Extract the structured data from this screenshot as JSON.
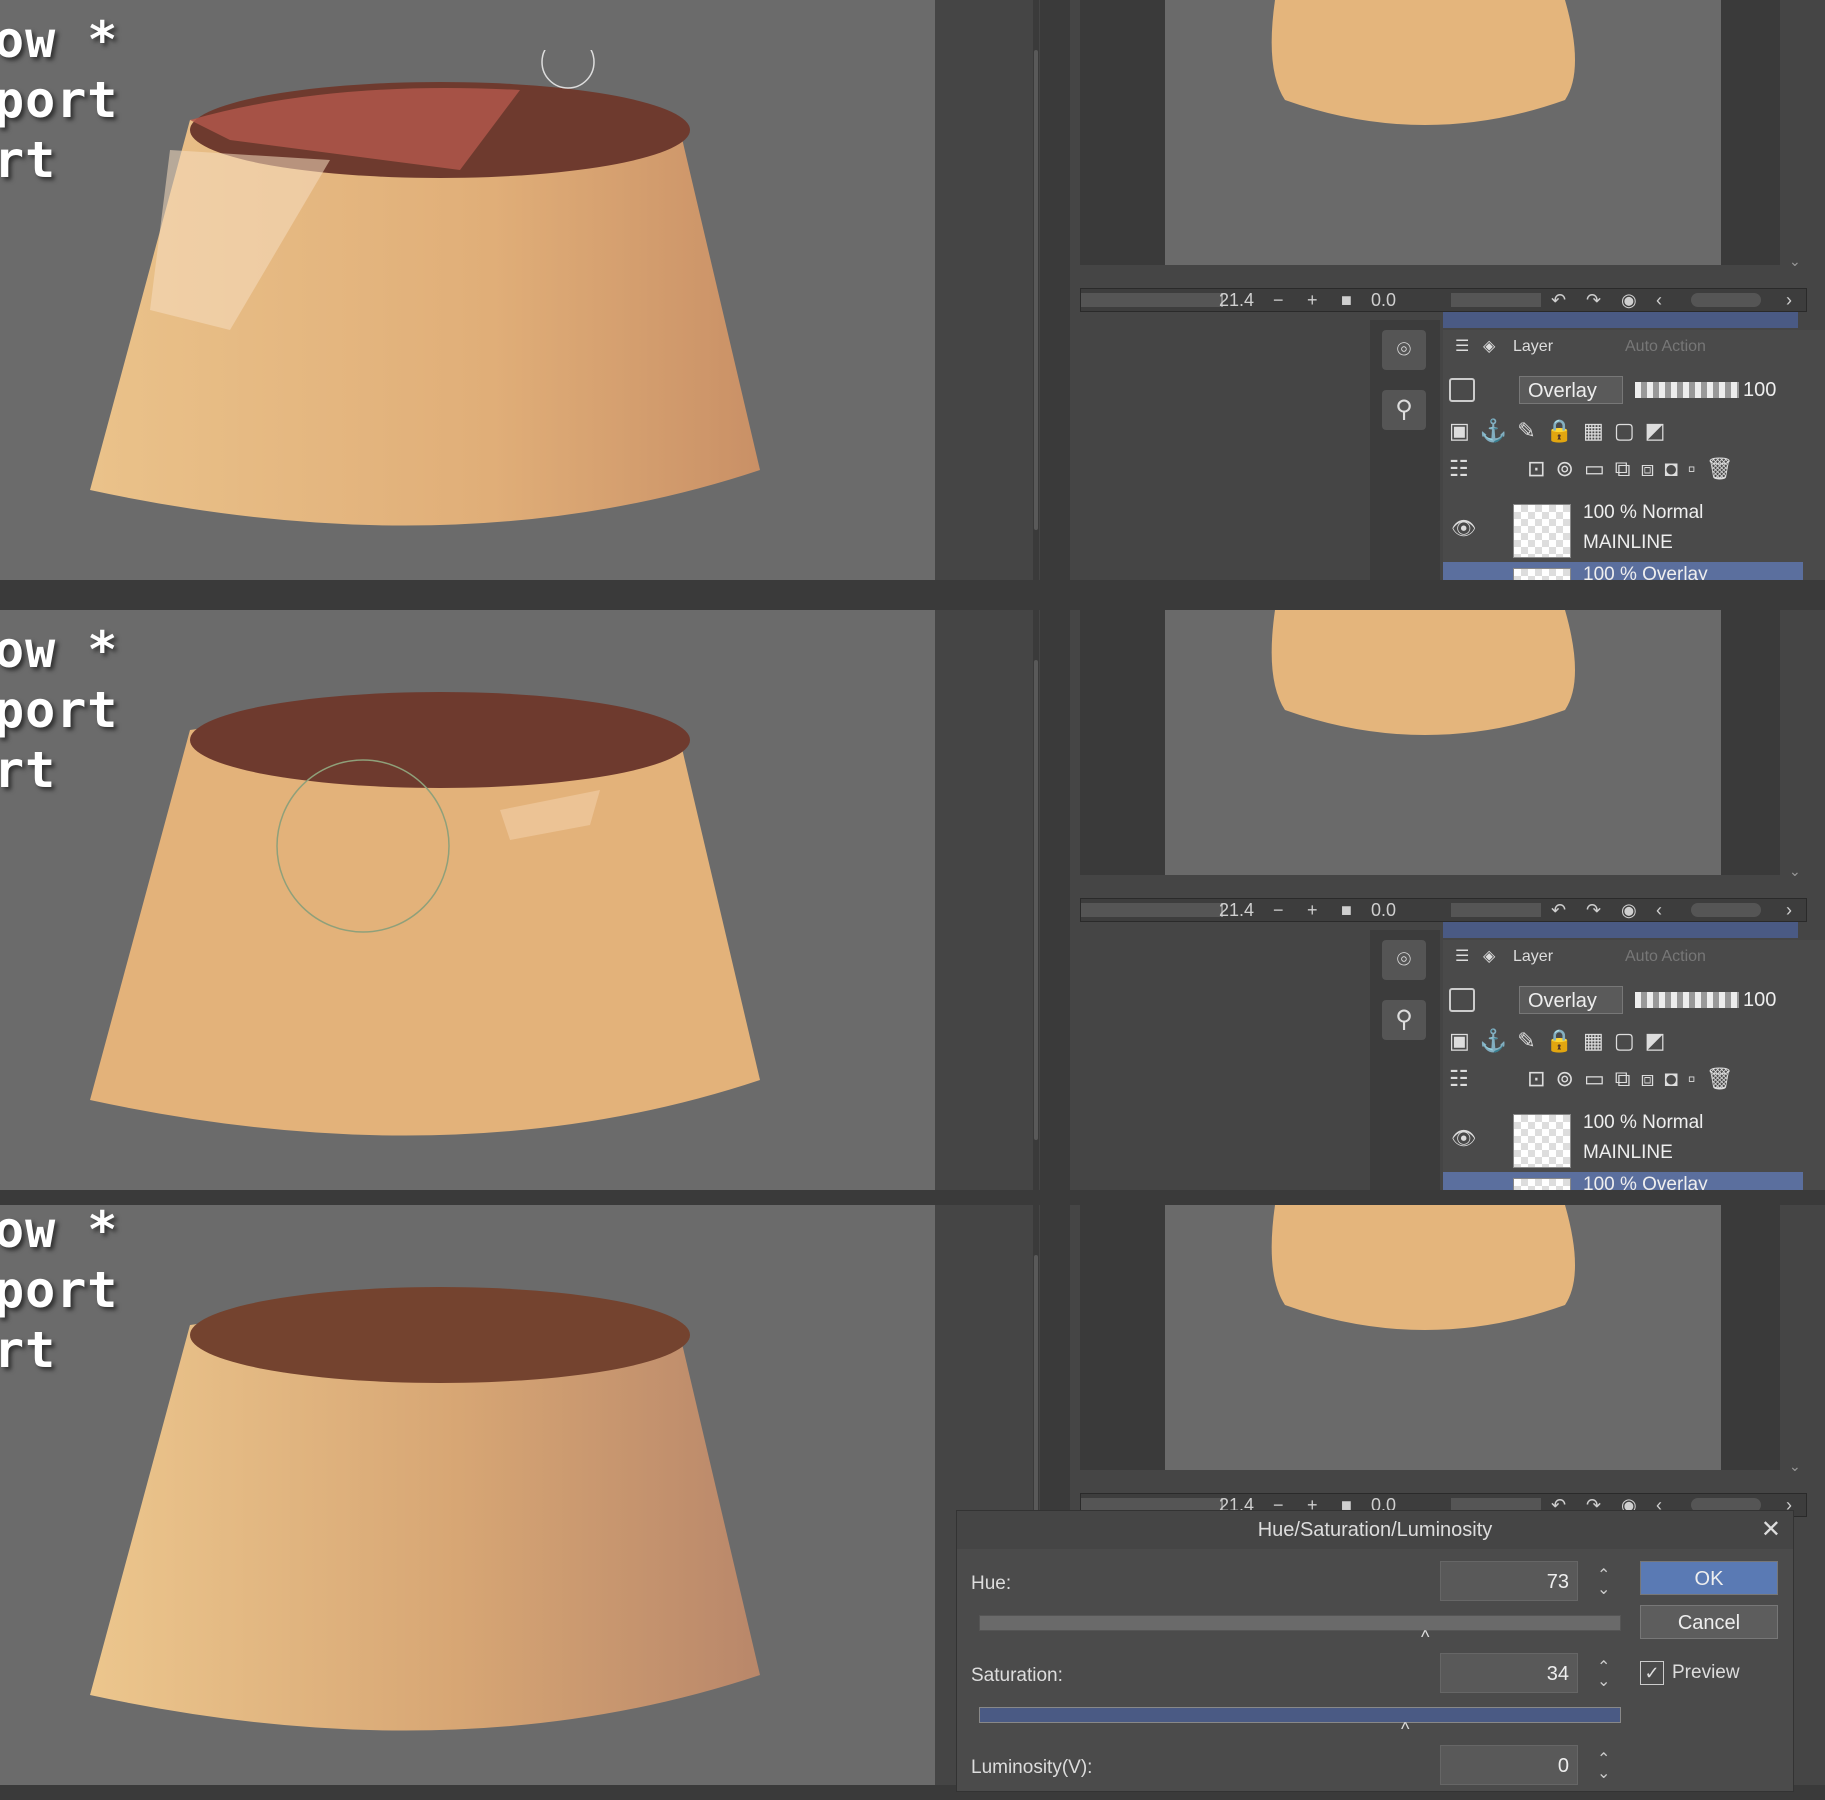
{
  "overlay": {
    "lines": [
      "ow *",
      "port",
      "rt"
    ]
  },
  "navigator": {
    "zoom_value": "21.4",
    "rotate_value": "0.0",
    "minus": "−",
    "plus": "+"
  },
  "layer_panel": {
    "tab_layer": "Layer",
    "tab_auto_action": "Auto Action",
    "blend_mode": "Overlay",
    "opacity": "100",
    "layers": [
      {
        "mode": "100 % Normal",
        "name": "MAINLINE"
      },
      {
        "mode": "100 % Overlay",
        "name": ""
      }
    ]
  },
  "hsl_dialog": {
    "title": "Hue/Saturation/Luminosity",
    "hue_label": "Hue:",
    "hue_value": "73",
    "saturation_label": "Saturation:",
    "saturation_value": "34",
    "luminosity_label": "Luminosity(V):",
    "luminosity_value": "0",
    "ok": "OK",
    "cancel": "Cancel",
    "preview": "Preview",
    "preview_checked": true
  },
  "colors": {
    "canvas_bg": "#6b6b6b",
    "panel_bg": "#454545",
    "accent_blue": "#5a7ab4",
    "pudding_body": "#e8b97c",
    "pudding_top": "#6e3a2e"
  },
  "icons": [
    "layer-stack-icon",
    "camera-icon",
    "figure-icon",
    "eye-icon",
    "lock-icon",
    "trash-icon",
    "close-icon",
    "checkmark-icon"
  ]
}
